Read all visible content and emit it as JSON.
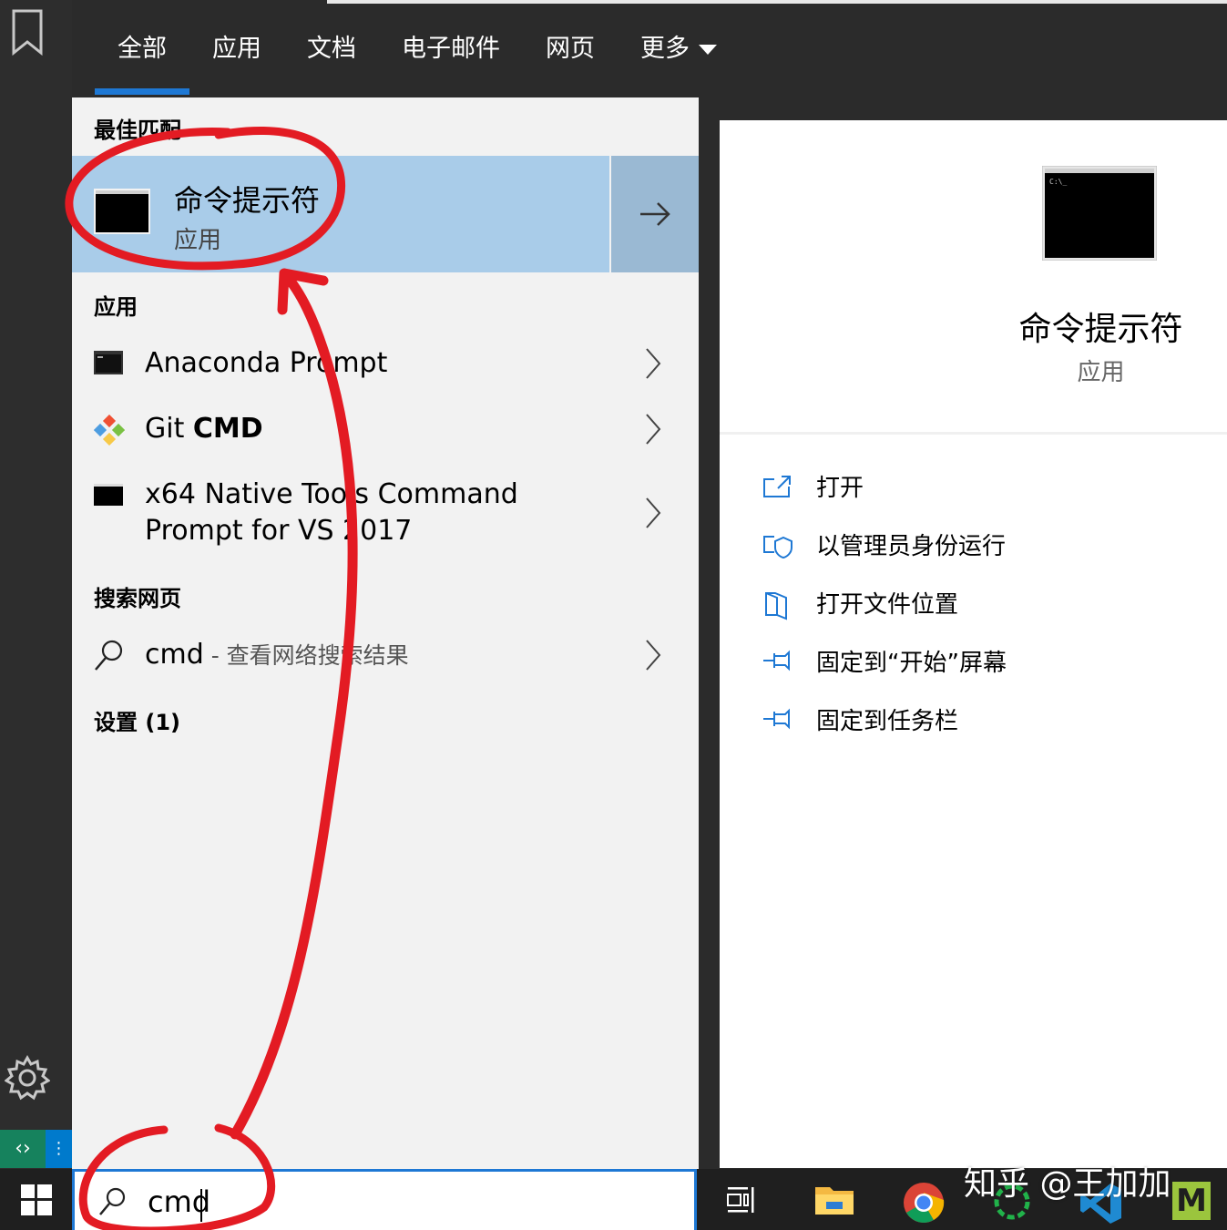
{
  "tabs": [
    {
      "label": "全部"
    },
    {
      "label": "应用"
    },
    {
      "label": "文档"
    },
    {
      "label": "电子邮件"
    },
    {
      "label": "网页"
    },
    {
      "label": "更多"
    }
  ],
  "sections": {
    "best_match": "最佳匹配",
    "apps": "应用",
    "web": "搜索网页",
    "settings": "设置 (1)"
  },
  "best_match": {
    "title": "命令提示符",
    "subtitle": "应用"
  },
  "apps": [
    {
      "label": "Anaconda Prompt"
    },
    {
      "label_pre": "Git ",
      "label_bold": "CMD"
    },
    {
      "line1": "x64 Native Tools Command",
      "line2": "Prompt for VS 2017"
    }
  ],
  "web_result": {
    "query": "cmd",
    "suffix": " - 查看网络搜索结果"
  },
  "preview": {
    "title": "命令提示符",
    "subtitle": "应用"
  },
  "actions": [
    {
      "label": "打开",
      "icon": "open-icon"
    },
    {
      "label": "以管理员身份运行",
      "icon": "admin-shield-icon"
    },
    {
      "label": "打开文件位置",
      "icon": "file-location-icon"
    },
    {
      "label": "固定到“开始”屏幕",
      "icon": "pin-icon"
    },
    {
      "label": "固定到任务栏",
      "icon": "pin-icon"
    }
  ],
  "search": {
    "value": "cmd"
  },
  "watermark": "知乎 @王加加",
  "colors": {
    "accent": "#1e78d4",
    "selected": "#a9cce9",
    "annotation": "#e31b23"
  }
}
